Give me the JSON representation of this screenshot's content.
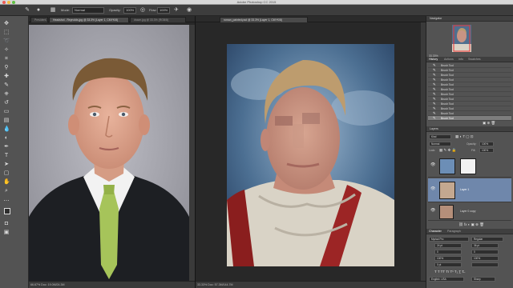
{
  "app": {
    "window_title": "Adobe Photoshop CC 2015"
  },
  "options_bar": {
    "mode_label": "Mode:",
    "mode_value": "Normal",
    "opacity_label": "Opacity:",
    "opacity_value": "100%",
    "flow_label": "Flow:",
    "flow_value": "100%"
  },
  "documents": {
    "left": {
      "tabs": [
        "President...",
        "Headshot - Reynolds.jpg @ 33.3% (Layer 1, CMYK/8)",
        "drawn.jpg @ 33.3% (RGB/8)"
      ],
      "status_text": "66.67%     Doc: 19.0M/24.3M"
    },
    "right": {
      "tabs": [
        "roman_painted.psd @ 33.3% (Layer 1, CMYK/8)"
      ],
      "status_text": "33.33%     Doc: 57.3M/144.7M"
    }
  },
  "panels": {
    "navigator": {
      "title": "Navigator",
      "zoom": "33.33%"
    },
    "history": {
      "tabs": [
        "History",
        "Actions",
        "Info",
        "Swatches"
      ],
      "items": [
        "Brush Tool",
        "Brush Tool",
        "Brush Tool",
        "Brush Tool",
        "Brush Tool",
        "Brush Tool",
        "Brush Tool",
        "Brush Tool",
        "Brush Tool",
        "Brush Tool",
        "Brush Tool",
        "Brush Tool"
      ],
      "selected_index": 11
    },
    "layers": {
      "title": "Layers",
      "kind_label": "Kind",
      "blend_mode": "Normal",
      "opacity_label": "Opacity:",
      "opacity_value": "100%",
      "fill_label": "Fill:",
      "fill_value": "100%",
      "lock_label": "Lock:",
      "items": [
        {
          "name": "",
          "selected": false
        },
        {
          "name": "Layer 1",
          "selected": true
        },
        {
          "name": "Layer 0 copy",
          "selected": false
        }
      ]
    },
    "properties": {
      "tabs": [
        "Character",
        "Paragraph"
      ],
      "font_family": "Myriad Pro",
      "font_style": "Regular",
      "size": "24 pt",
      "leading": "36 pt",
      "tracking": "0",
      "scale_v": "100%",
      "scale_h": "100%",
      "baseline": "0 pt",
      "language": "English: USA",
      "aa": "Sharp"
    }
  },
  "colors": {
    "accent_selection": "#6f87ab",
    "ui_dark": "#282828",
    "ui_mid": "#535353"
  }
}
